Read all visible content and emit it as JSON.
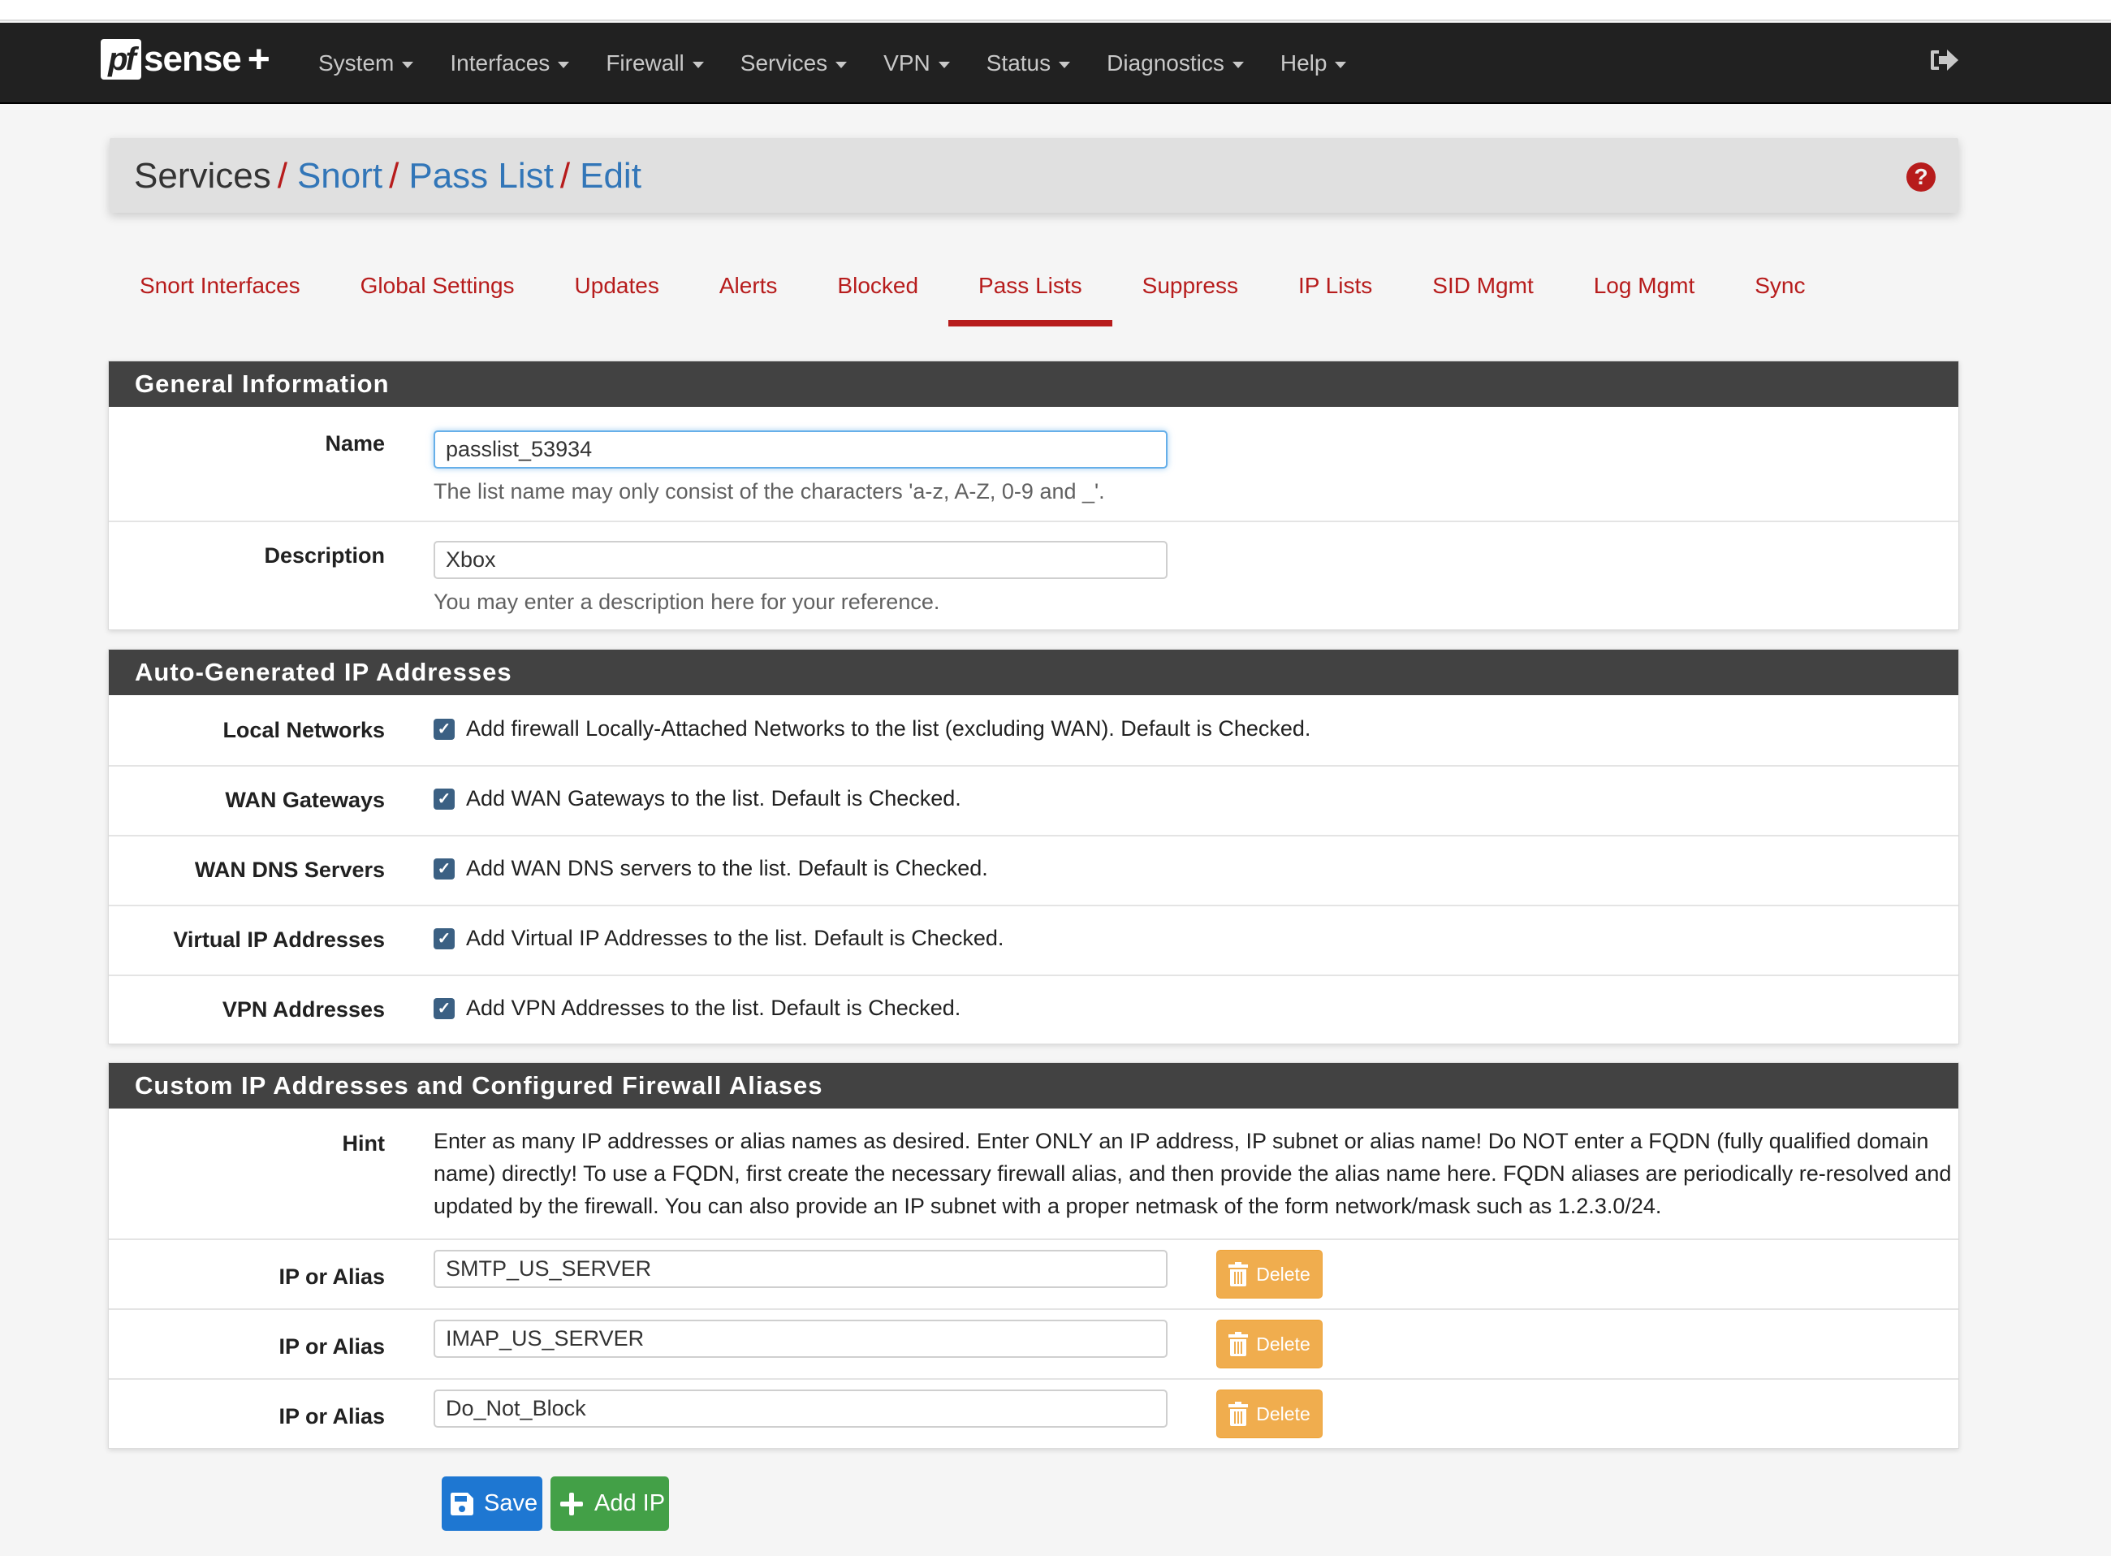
{
  "app": {
    "logo_prefix": "pf",
    "logo_text": "sense",
    "logo_suffix": "+"
  },
  "nav": {
    "items": [
      {
        "label": "System"
      },
      {
        "label": "Interfaces"
      },
      {
        "label": "Firewall"
      },
      {
        "label": "Services"
      },
      {
        "label": "VPN"
      },
      {
        "label": "Status"
      },
      {
        "label": "Diagnostics"
      },
      {
        "label": "Help"
      }
    ],
    "logout_icon": "sign-out-icon"
  },
  "breadcrumb": {
    "items": [
      "Services",
      "Snort",
      "Pass List",
      "Edit"
    ],
    "separator": "/",
    "help_icon": "question-circle-icon",
    "help_glyph": "?"
  },
  "tabs": {
    "items": [
      {
        "label": "Snort Interfaces",
        "active": false
      },
      {
        "label": "Global Settings",
        "active": false
      },
      {
        "label": "Updates",
        "active": false
      },
      {
        "label": "Alerts",
        "active": false
      },
      {
        "label": "Blocked",
        "active": false
      },
      {
        "label": "Pass Lists",
        "active": true
      },
      {
        "label": "Suppress",
        "active": false
      },
      {
        "label": "IP Lists",
        "active": false
      },
      {
        "label": "SID Mgmt",
        "active": false
      },
      {
        "label": "Log Mgmt",
        "active": false
      },
      {
        "label": "Sync",
        "active": false
      }
    ]
  },
  "general": {
    "heading": "General Information",
    "name": {
      "label": "Name",
      "value": "passlist_53934",
      "help": "The list name may only consist of the characters 'a-z, A-Z, 0-9 and _'."
    },
    "description": {
      "label": "Description",
      "value": "Xbox",
      "help": "You may enter a description here for your reference."
    }
  },
  "auto": {
    "heading": "Auto-Generated IP Addresses",
    "rows": [
      {
        "label": "Local Networks",
        "text": "Add firewall Locally-Attached Networks to the list (excluding WAN). Default is Checked.",
        "checked": true
      },
      {
        "label": "WAN Gateways",
        "text": "Add WAN Gateways to the list. Default is Checked.",
        "checked": true
      },
      {
        "label": "WAN DNS Servers",
        "text": "Add WAN DNS servers to the list. Default is Checked.",
        "checked": true
      },
      {
        "label": "Virtual IP Addresses",
        "text": "Add Virtual IP Addresses to the list. Default is Checked.",
        "checked": true
      },
      {
        "label": "VPN Addresses",
        "text": "Add VPN Addresses to the list. Default is Checked.",
        "checked": true
      }
    ]
  },
  "custom": {
    "heading": "Custom IP Addresses and Configured Firewall Aliases",
    "hint_label": "Hint",
    "hint_text": "Enter as many IP addresses or alias names as desired. Enter ONLY an IP address, IP subnet or alias name! Do NOT enter a FQDN (fully qualified domain name) directly! To use a FQDN, first create the necessary firewall alias, and then provide the alias name here. FQDN aliases are periodically re-resolved and updated by the firewall. You can also provide an IP subnet with a proper netmask of the form network/mask such as 1.2.3.0/24.",
    "entries": [
      {
        "label": "IP or Alias",
        "value": "SMTP_US_SERVER",
        "delete_label": "Delete"
      },
      {
        "label": "IP or Alias",
        "value": "IMAP_US_SERVER",
        "delete_label": "Delete"
      },
      {
        "label": "IP or Alias",
        "value": "Do_Not_Block",
        "delete_label": "Delete"
      }
    ]
  },
  "actions": {
    "save_label": "Save",
    "add_ip_label": "Add IP"
  },
  "colors": {
    "brand_red": "#b71c1c",
    "link_blue": "#3276b8",
    "navbar_bg": "#212121",
    "panel_heading_bg": "#424242",
    "checkbox": "#3b6083",
    "delete_orange": "#f0ad4e",
    "save_blue": "#1e77d2",
    "add_green": "#43a047"
  }
}
